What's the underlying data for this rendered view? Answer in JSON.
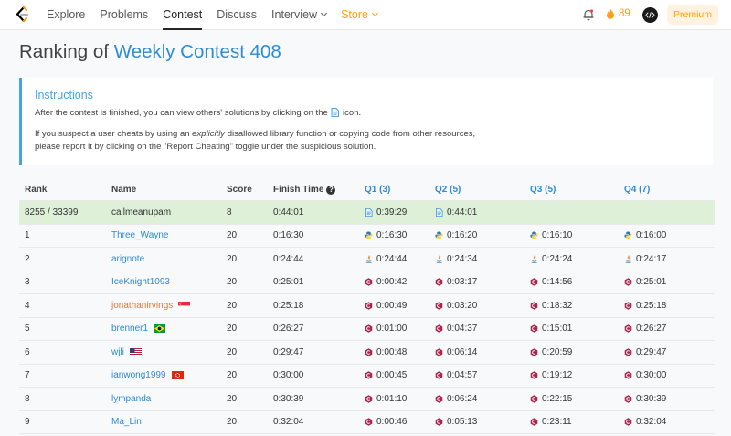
{
  "nav": {
    "items": [
      {
        "label": "Explore"
      },
      {
        "label": "Problems"
      },
      {
        "label": "Contest"
      },
      {
        "label": "Discuss"
      },
      {
        "label": "Interview"
      },
      {
        "label": "Store"
      }
    ],
    "streak_count": "89",
    "premium_label": "Premium"
  },
  "page": {
    "title_prefix": "Ranking of",
    "contest_name": "Weekly Contest 408"
  },
  "instructions": {
    "heading": "Instructions",
    "line1_a": "After the contest is finished, you can view others' solutions by clicking on the",
    "line1_b": "icon.",
    "line2_a": "If you suspect a user cheats by using an",
    "line2_em": "explicitly",
    "line2_b": "disallowed library function or copying code from other resources,",
    "line3": "please report it by clicking on the \"Report Cheating\" toggle under the suspicious solution."
  },
  "table": {
    "headers": {
      "rank": "Rank",
      "name": "Name",
      "score": "Score",
      "finish_time": "Finish Time",
      "q1": "Q1 (3)",
      "q2": "Q2 (5)",
      "q3": "Q3 (5)",
      "q4": "Q4 (7)"
    },
    "my_row": {
      "rank": "8255 / 33399",
      "name": "callmeanupam",
      "score": "8",
      "finish_time": "0:44:01",
      "q1": "0:39:29",
      "q2": "0:44:01"
    },
    "rows": [
      {
        "rank": "1",
        "name": "Three_Wayne",
        "score": "20",
        "finish": "0:16:30",
        "q1": "0:16:30",
        "q2": "0:16:20",
        "q3": "0:16:10",
        "q4": "0:16:00",
        "lang": "python",
        "flag": ""
      },
      {
        "rank": "2",
        "name": "arignote",
        "score": "20",
        "finish": "0:24:44",
        "q1": "0:24:44",
        "q2": "0:24:34",
        "q3": "0:24:24",
        "q4": "0:24:17",
        "lang": "java",
        "flag": ""
      },
      {
        "rank": "3",
        "name": "IceKnight1093",
        "score": "20",
        "finish": "0:25:01",
        "q1": "0:00:42",
        "q2": "0:03:17",
        "q3": "0:14:56",
        "q4": "0:25:01",
        "lang": "cpp",
        "flag": ""
      },
      {
        "rank": "4",
        "name": "jonathanirvings",
        "score": "20",
        "finish": "0:25:18",
        "q1": "0:00:49",
        "q2": "0:03:20",
        "q3": "0:18:32",
        "q4": "0:25:18",
        "lang": "cpp",
        "flag": "singapore"
      },
      {
        "rank": "5",
        "name": "brenner1",
        "score": "20",
        "finish": "0:26:27",
        "q1": "0:01:00",
        "q2": "0:04:37",
        "q3": "0:15:01",
        "q4": "0:26:27",
        "lang": "cpp",
        "flag": "brazil"
      },
      {
        "rank": "6",
        "name": "wjli",
        "score": "20",
        "finish": "0:29:47",
        "q1": "0:00:48",
        "q2": "0:06:14",
        "q3": "0:20:59",
        "q4": "0:29:47",
        "lang": "cpp",
        "flag": "usa"
      },
      {
        "rank": "7",
        "name": "ianwong1999",
        "score": "20",
        "finish": "0:30:00",
        "q1": "0:00:45",
        "q2": "0:04:57",
        "q3": "0:19:12",
        "q4": "0:30:00",
        "lang": "cpp",
        "flag": "hongkong"
      },
      {
        "rank": "8",
        "name": "lympanda",
        "score": "20",
        "finish": "0:30:39",
        "q1": "0:01:10",
        "q2": "0:06:24",
        "q3": "0:22:15",
        "q4": "0:30:39",
        "lang": "cpp",
        "flag": ""
      },
      {
        "rank": "9",
        "name": "Ma_Lin",
        "score": "20",
        "finish": "0:32:04",
        "q1": "0:00:46",
        "q2": "0:05:13",
        "q3": "0:23:11",
        "q4": "0:32:04",
        "lang": "cpp",
        "flag": ""
      }
    ]
  },
  "colors": {
    "accent_blue": "#2d8ad6",
    "brand_orange": "#ffa116",
    "my_row_green": "#dff0d8"
  }
}
